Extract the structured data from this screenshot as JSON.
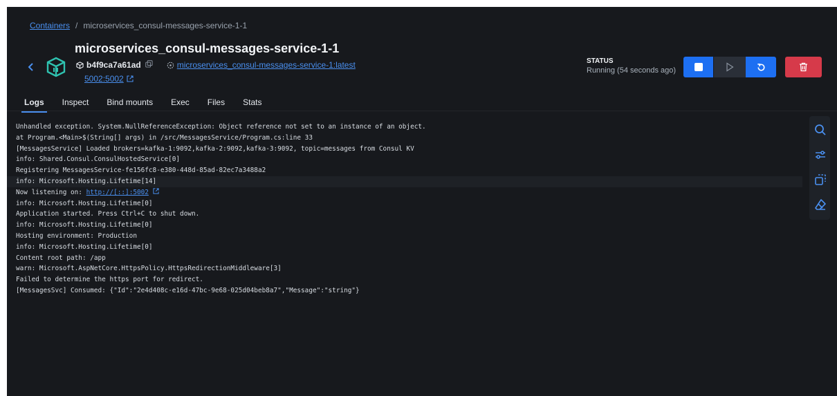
{
  "breadcrumb": {
    "root": "Containers",
    "separator": "/",
    "current": "microservices_consul-messages-service-1-1"
  },
  "container": {
    "name": "microservices_consul-messages-service-1-1",
    "id": "b4f9ca7a61ad",
    "image": "microservices_consul-messages-service-1:latest",
    "port": "5002:5002"
  },
  "status": {
    "label": "STATUS",
    "value": "Running (54 seconds ago)"
  },
  "colors": {
    "accent": "#1d6ff2",
    "danger": "#d63a4a",
    "background": "#17191d",
    "link": "#4a90f0"
  },
  "tabs": [
    {
      "label": "Logs",
      "active": true
    },
    {
      "label": "Inspect"
    },
    {
      "label": "Bind mounts"
    },
    {
      "label": "Exec"
    },
    {
      "label": "Files"
    },
    {
      "label": "Stats"
    }
  ],
  "logs": [
    "Unhandled exception. System.NullReferenceException: Object reference not set to an instance of an object.",
    "at Program.<Main>$(String[] args) in /src/MessagesService/Program.cs:line 33",
    "[MessagesService] Loaded brokers=kafka-1:9092,kafka-2:9092,kafka-3:9092, topic=messages from Consul KV",
    "info: Shared.Consul.ConsulHostedService[0]",
    "Registering MessagesService-fe156fc8-e380-448d-85ad-82ec7a3488a2",
    "info: Microsoft.Hosting.Lifetime[14]",
    {
      "prefix": "Now listening on: ",
      "link": "http://[::]:5002"
    },
    "info: Microsoft.Hosting.Lifetime[0]",
    "Application started. Press Ctrl+C to shut down.",
    "info: Microsoft.Hosting.Lifetime[0]",
    "Hosting environment: Production",
    "info: Microsoft.Hosting.Lifetime[0]",
    "Content root path: /app",
    "warn: Microsoft.AspNetCore.HttpsPolicy.HttpsRedirectionMiddleware[3]",
    "Failed to determine the https port for redirect.",
    "[MessagesSvc] Consumed: {\"Id\":\"2e4d408c-e16d-47bc-9e68-025d04beb8a7\",\"Message\":\"string\"}"
  ],
  "icons": [
    "chevron-left-icon",
    "container-icon",
    "cube-icon",
    "copy-icon",
    "image-icon",
    "external-link-icon",
    "stop-icon",
    "play-icon",
    "restart-icon",
    "trash-icon",
    "search-icon",
    "filter-icon",
    "copy-logs-icon",
    "eraser-icon"
  ]
}
